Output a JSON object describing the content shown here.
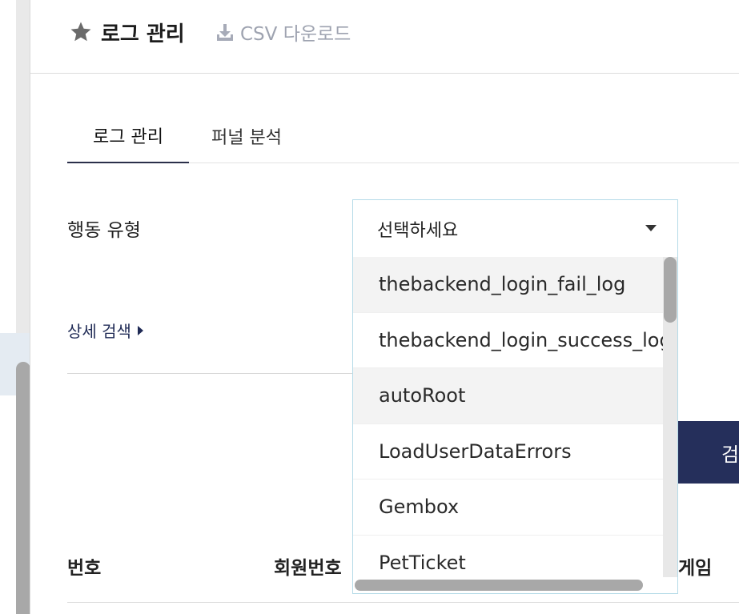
{
  "header": {
    "title": "로그 관리",
    "csv_label": "CSV 다운로드"
  },
  "tabs": [
    {
      "label": "로그 관리",
      "active": true
    },
    {
      "label": "퍼널 분석",
      "active": false
    }
  ],
  "filter": {
    "action_type_label": "행동 유형",
    "select_placeholder": "선택하세요",
    "options": [
      "thebackend_login_fail_log",
      "thebackend_login_success_log",
      "autoRoot",
      "LoadUserDataErrors",
      "Gembox",
      "PetTicket"
    ]
  },
  "detail_search_label": "상세 검색",
  "search_button_label": "검색",
  "table": {
    "columns": [
      "번호",
      "회원번호",
      "게임"
    ]
  },
  "colors": {
    "primary": "#252f5b",
    "link": "#1f2a55",
    "muted": "#9ea3b0",
    "select_border": "#b5dbe8"
  }
}
